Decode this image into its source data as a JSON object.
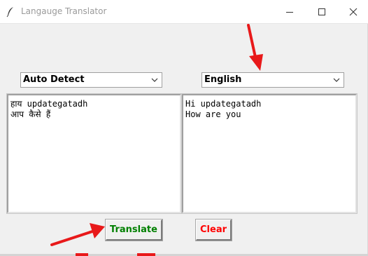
{
  "window": {
    "title": "Langauge Translator",
    "background": "#f0f0f0"
  },
  "source": {
    "language": "Auto Detect",
    "lines": [
      "हाय updategatadh",
      "आप कैसे हैं"
    ]
  },
  "target": {
    "language": "English",
    "lines": [
      "Hi updategatadh",
      "How are you"
    ]
  },
  "buttons": {
    "translate_label": "Translate",
    "translate_color": "#008000",
    "clear_label": "Clear",
    "clear_color": "#ff0000"
  },
  "annotations": {
    "arrow_color": "#e8191a"
  }
}
